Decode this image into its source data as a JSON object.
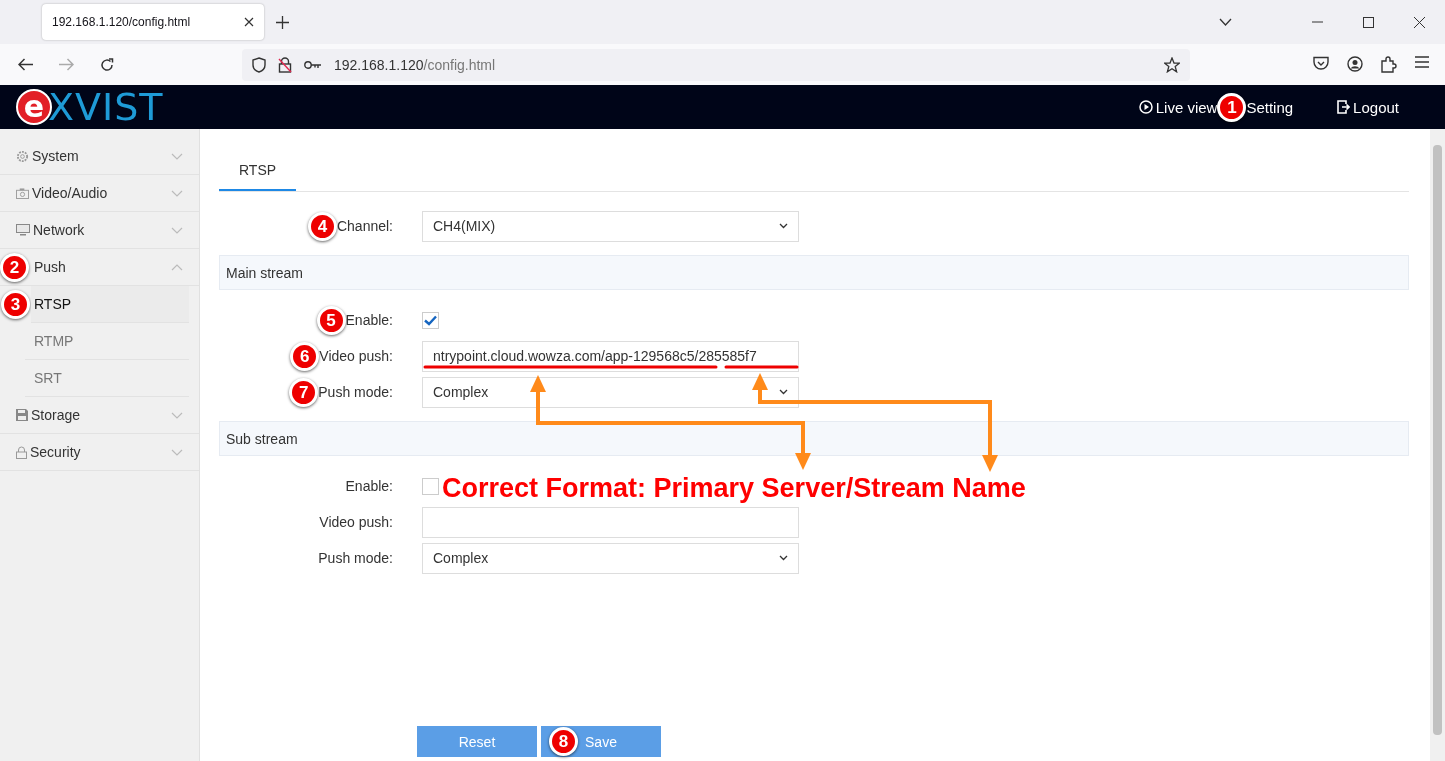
{
  "browser": {
    "tab_title": "192.168.1.120/config.html",
    "url_host": "192.168.1.120",
    "url_path": "/config.html"
  },
  "header": {
    "logo": {
      "mark": "e",
      "text": "XVIST"
    },
    "nav": [
      {
        "label": "Live view",
        "kind": "play"
      },
      {
        "label": "Setting",
        "kind": "plain",
        "badge": "1"
      },
      {
        "label": "Logout",
        "kind": "logout"
      }
    ]
  },
  "sidebar": {
    "items": [
      {
        "label": "System",
        "kind": "gear",
        "expanded": false
      },
      {
        "label": "Video/Audio",
        "kind": "camera",
        "expanded": false
      },
      {
        "label": "Network",
        "kind": "monitor",
        "expanded": false
      },
      {
        "label": "Push",
        "kind": "plain",
        "expanded": true,
        "badge": "2",
        "children": [
          {
            "label": "RTSP",
            "selected": true,
            "badge": "3"
          },
          {
            "label": "RTMP",
            "selected": false
          },
          {
            "label": "SRT",
            "selected": false
          }
        ]
      },
      {
        "label": "Storage",
        "kind": "disk",
        "expanded": false
      },
      {
        "label": "Security",
        "kind": "lock",
        "expanded": false
      }
    ]
  },
  "tabs": [
    {
      "label": "RTSP",
      "selected": true
    }
  ],
  "form": {
    "rows": [
      {
        "kind": "select",
        "label": "Channel:",
        "value": "CH4(MIX)",
        "badge": "4"
      }
    ],
    "sections": [
      {
        "title": "Main stream",
        "rows": [
          {
            "kind": "checkbox",
            "label": "Enable:",
            "checked": true,
            "badge": "5"
          },
          {
            "kind": "text",
            "label": "Video push:",
            "value": "ntrypoint.cloud.wowza.com/app-129568c5/285585f7",
            "badge": "6"
          },
          {
            "kind": "select",
            "label": "Push mode:",
            "value": "Complex",
            "badge": "7"
          }
        ]
      },
      {
        "title": "Sub stream",
        "rows": [
          {
            "kind": "checkbox",
            "label": "Enable:",
            "checked": false,
            "note": "Correct Format: Primary Server/Stream Name"
          },
          {
            "kind": "text",
            "label": "Video push:"
          },
          {
            "kind": "select",
            "label": "Push mode:",
            "value": "Complex"
          }
        ]
      }
    ]
  },
  "buttons": [
    {
      "label": "Reset"
    },
    {
      "label": "Save",
      "badge": "8"
    }
  ]
}
